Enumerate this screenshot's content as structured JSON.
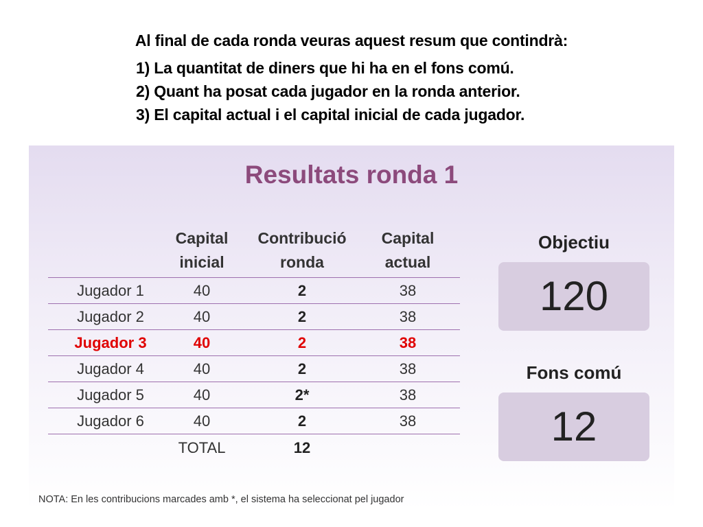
{
  "intro": {
    "heading": "Al final de cada ronda veuras aquest resum que contindrà:",
    "items": [
      "1) La quantitat de diners que hi ha en el fons comú.",
      "2) Quant ha posat cada jugador en la ronda anterior.",
      "3) El capital actual i el capital inicial de cada jugador."
    ]
  },
  "panel": {
    "title": "Resultats ronda 1",
    "columns": {
      "initial": [
        "Capital",
        "inicial"
      ],
      "contribution": [
        "Contribució",
        "ronda"
      ],
      "current": [
        "Capital",
        "actual"
      ]
    },
    "rows": [
      {
        "name": "Jugador 1",
        "initial": "40",
        "contribution": "2",
        "current": "38"
      },
      {
        "name": "Jugador 2",
        "initial": "40",
        "contribution": "2",
        "current": "38"
      },
      {
        "name": "Jugador 3",
        "initial": "40",
        "contribution": "2",
        "current": "38"
      },
      {
        "name": "Jugador 4",
        "initial": "40",
        "contribution": "2",
        "current": "38"
      },
      {
        "name": "Jugador 5",
        "initial": "40",
        "contribution": "2*",
        "current": "38"
      },
      {
        "name": "Jugador 6",
        "initial": "40",
        "contribution": "2",
        "current": "38"
      }
    ],
    "highlight_color": "#e00000",
    "total": {
      "label": "TOTAL",
      "value": "12"
    },
    "goal": {
      "label": "Objectiu",
      "value": "120"
    },
    "pot": {
      "label": "Fons comú",
      "value": "12"
    },
    "note": "NOTA: En les contribucions marcades amb *, el sistema ha seleccionat pel jugador"
  }
}
